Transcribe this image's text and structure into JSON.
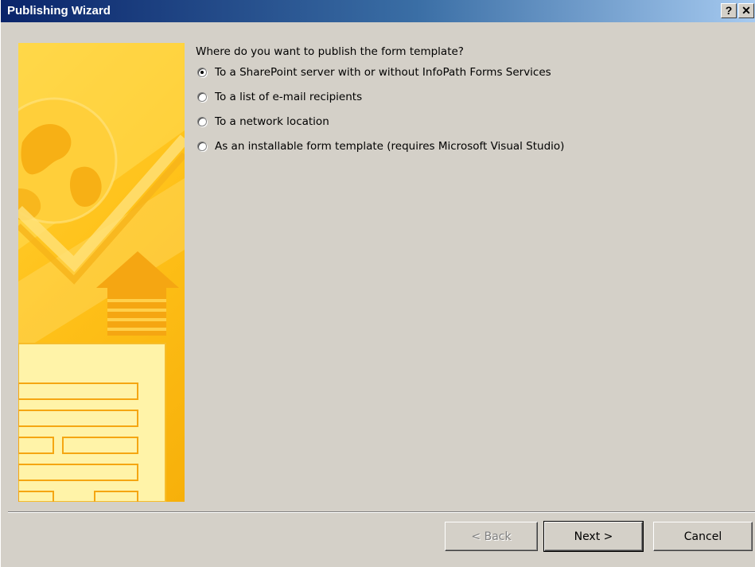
{
  "window": {
    "title": "Publishing Wizard",
    "help_label": "?",
    "close_label": "✕"
  },
  "question": "Where do you want to publish the form template?",
  "options": [
    {
      "label": "To a SharePoint server with or without InfoPath Forms Services",
      "selected": true
    },
    {
      "label": "To a list of e-mail recipients",
      "selected": false
    },
    {
      "label": "To a network location",
      "selected": false
    },
    {
      "label": "As an installable form template (requires Microsoft Visual Studio)",
      "selected": false
    }
  ],
  "buttons": {
    "back": "< Back",
    "next": "Next >",
    "cancel": "Cancel"
  },
  "banner_icons": [
    "globe-icon",
    "checkmark-icon",
    "up-arrow-icon",
    "form-icon"
  ]
}
